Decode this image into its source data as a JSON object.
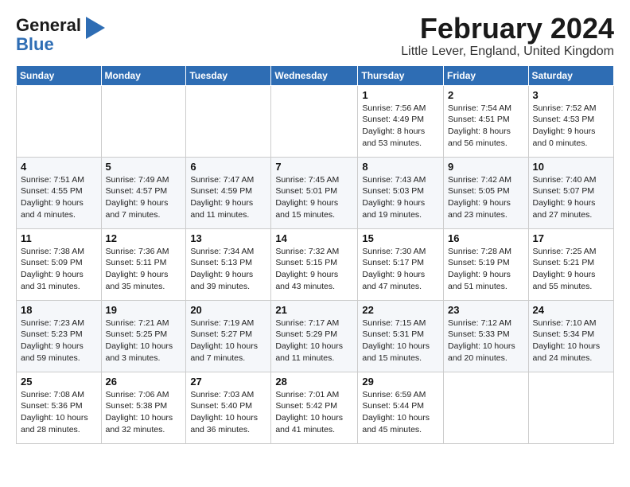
{
  "logo": {
    "line1": "General",
    "line2": "Blue",
    "icon": "▶"
  },
  "header": {
    "month_year": "February 2024",
    "location": "Little Lever, England, United Kingdom"
  },
  "weekdays": [
    "Sunday",
    "Monday",
    "Tuesday",
    "Wednesday",
    "Thursday",
    "Friday",
    "Saturday"
  ],
  "weeks": [
    [
      {
        "day": "",
        "info": ""
      },
      {
        "day": "",
        "info": ""
      },
      {
        "day": "",
        "info": ""
      },
      {
        "day": "",
        "info": ""
      },
      {
        "day": "1",
        "info": "Sunrise: 7:56 AM\nSunset: 4:49 PM\nDaylight: 8 hours\nand 53 minutes."
      },
      {
        "day": "2",
        "info": "Sunrise: 7:54 AM\nSunset: 4:51 PM\nDaylight: 8 hours\nand 56 minutes."
      },
      {
        "day": "3",
        "info": "Sunrise: 7:52 AM\nSunset: 4:53 PM\nDaylight: 9 hours\nand 0 minutes."
      }
    ],
    [
      {
        "day": "4",
        "info": "Sunrise: 7:51 AM\nSunset: 4:55 PM\nDaylight: 9 hours\nand 4 minutes."
      },
      {
        "day": "5",
        "info": "Sunrise: 7:49 AM\nSunset: 4:57 PM\nDaylight: 9 hours\nand 7 minutes."
      },
      {
        "day": "6",
        "info": "Sunrise: 7:47 AM\nSunset: 4:59 PM\nDaylight: 9 hours\nand 11 minutes."
      },
      {
        "day": "7",
        "info": "Sunrise: 7:45 AM\nSunset: 5:01 PM\nDaylight: 9 hours\nand 15 minutes."
      },
      {
        "day": "8",
        "info": "Sunrise: 7:43 AM\nSunset: 5:03 PM\nDaylight: 9 hours\nand 19 minutes."
      },
      {
        "day": "9",
        "info": "Sunrise: 7:42 AM\nSunset: 5:05 PM\nDaylight: 9 hours\nand 23 minutes."
      },
      {
        "day": "10",
        "info": "Sunrise: 7:40 AM\nSunset: 5:07 PM\nDaylight: 9 hours\nand 27 minutes."
      }
    ],
    [
      {
        "day": "11",
        "info": "Sunrise: 7:38 AM\nSunset: 5:09 PM\nDaylight: 9 hours\nand 31 minutes."
      },
      {
        "day": "12",
        "info": "Sunrise: 7:36 AM\nSunset: 5:11 PM\nDaylight: 9 hours\nand 35 minutes."
      },
      {
        "day": "13",
        "info": "Sunrise: 7:34 AM\nSunset: 5:13 PM\nDaylight: 9 hours\nand 39 minutes."
      },
      {
        "day": "14",
        "info": "Sunrise: 7:32 AM\nSunset: 5:15 PM\nDaylight: 9 hours\nand 43 minutes."
      },
      {
        "day": "15",
        "info": "Sunrise: 7:30 AM\nSunset: 5:17 PM\nDaylight: 9 hours\nand 47 minutes."
      },
      {
        "day": "16",
        "info": "Sunrise: 7:28 AM\nSunset: 5:19 PM\nDaylight: 9 hours\nand 51 minutes."
      },
      {
        "day": "17",
        "info": "Sunrise: 7:25 AM\nSunset: 5:21 PM\nDaylight: 9 hours\nand 55 minutes."
      }
    ],
    [
      {
        "day": "18",
        "info": "Sunrise: 7:23 AM\nSunset: 5:23 PM\nDaylight: 9 hours\nand 59 minutes."
      },
      {
        "day": "19",
        "info": "Sunrise: 7:21 AM\nSunset: 5:25 PM\nDaylight: 10 hours\nand 3 minutes."
      },
      {
        "day": "20",
        "info": "Sunrise: 7:19 AM\nSunset: 5:27 PM\nDaylight: 10 hours\nand 7 minutes."
      },
      {
        "day": "21",
        "info": "Sunrise: 7:17 AM\nSunset: 5:29 PM\nDaylight: 10 hours\nand 11 minutes."
      },
      {
        "day": "22",
        "info": "Sunrise: 7:15 AM\nSunset: 5:31 PM\nDaylight: 10 hours\nand 15 minutes."
      },
      {
        "day": "23",
        "info": "Sunrise: 7:12 AM\nSunset: 5:33 PM\nDaylight: 10 hours\nand 20 minutes."
      },
      {
        "day": "24",
        "info": "Sunrise: 7:10 AM\nSunset: 5:34 PM\nDaylight: 10 hours\nand 24 minutes."
      }
    ],
    [
      {
        "day": "25",
        "info": "Sunrise: 7:08 AM\nSunset: 5:36 PM\nDaylight: 10 hours\nand 28 minutes."
      },
      {
        "day": "26",
        "info": "Sunrise: 7:06 AM\nSunset: 5:38 PM\nDaylight: 10 hours\nand 32 minutes."
      },
      {
        "day": "27",
        "info": "Sunrise: 7:03 AM\nSunset: 5:40 PM\nDaylight: 10 hours\nand 36 minutes."
      },
      {
        "day": "28",
        "info": "Sunrise: 7:01 AM\nSunset: 5:42 PM\nDaylight: 10 hours\nand 41 minutes."
      },
      {
        "day": "29",
        "info": "Sunrise: 6:59 AM\nSunset: 5:44 PM\nDaylight: 10 hours\nand 45 minutes."
      },
      {
        "day": "",
        "info": ""
      },
      {
        "day": "",
        "info": ""
      }
    ]
  ]
}
